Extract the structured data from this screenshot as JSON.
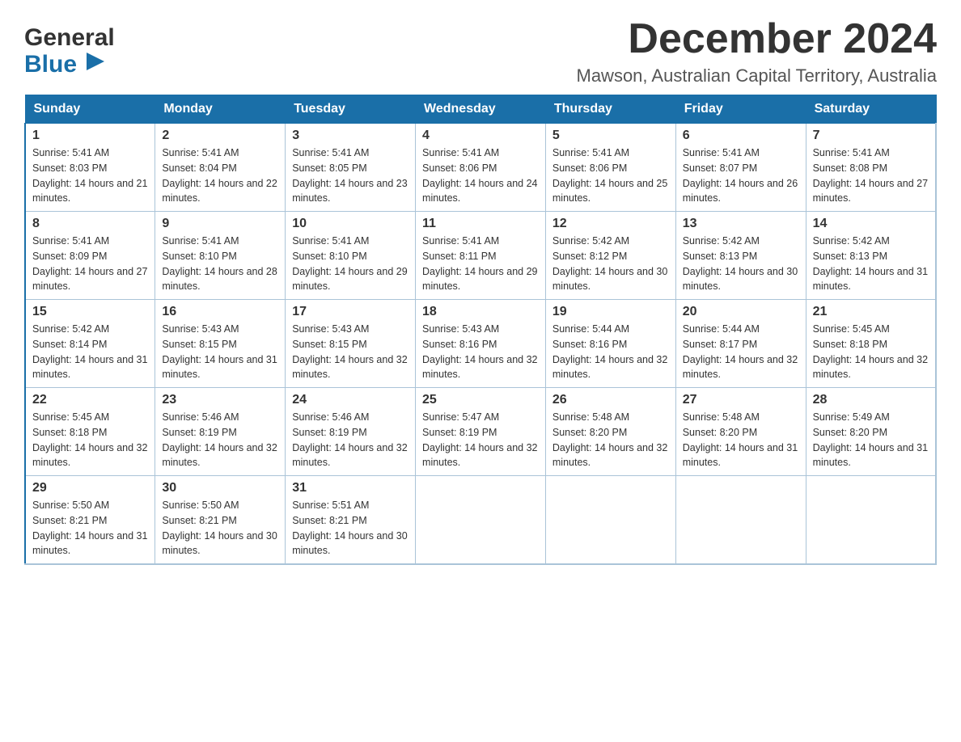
{
  "header": {
    "logo_general": "General",
    "logo_blue": "Blue",
    "month_title": "December 2024",
    "location": "Mawson, Australian Capital Territory, Australia"
  },
  "weekdays": [
    "Sunday",
    "Monday",
    "Tuesday",
    "Wednesday",
    "Thursday",
    "Friday",
    "Saturday"
  ],
  "weeks": [
    [
      {
        "day": "1",
        "sunrise": "5:41 AM",
        "sunset": "8:03 PM",
        "daylight": "14 hours and 21 minutes."
      },
      {
        "day": "2",
        "sunrise": "5:41 AM",
        "sunset": "8:04 PM",
        "daylight": "14 hours and 22 minutes."
      },
      {
        "day": "3",
        "sunrise": "5:41 AM",
        "sunset": "8:05 PM",
        "daylight": "14 hours and 23 minutes."
      },
      {
        "day": "4",
        "sunrise": "5:41 AM",
        "sunset": "8:06 PM",
        "daylight": "14 hours and 24 minutes."
      },
      {
        "day": "5",
        "sunrise": "5:41 AM",
        "sunset": "8:06 PM",
        "daylight": "14 hours and 25 minutes."
      },
      {
        "day": "6",
        "sunrise": "5:41 AM",
        "sunset": "8:07 PM",
        "daylight": "14 hours and 26 minutes."
      },
      {
        "day": "7",
        "sunrise": "5:41 AM",
        "sunset": "8:08 PM",
        "daylight": "14 hours and 27 minutes."
      }
    ],
    [
      {
        "day": "8",
        "sunrise": "5:41 AM",
        "sunset": "8:09 PM",
        "daylight": "14 hours and 27 minutes."
      },
      {
        "day": "9",
        "sunrise": "5:41 AM",
        "sunset": "8:10 PM",
        "daylight": "14 hours and 28 minutes."
      },
      {
        "day": "10",
        "sunrise": "5:41 AM",
        "sunset": "8:10 PM",
        "daylight": "14 hours and 29 minutes."
      },
      {
        "day": "11",
        "sunrise": "5:41 AM",
        "sunset": "8:11 PM",
        "daylight": "14 hours and 29 minutes."
      },
      {
        "day": "12",
        "sunrise": "5:42 AM",
        "sunset": "8:12 PM",
        "daylight": "14 hours and 30 minutes."
      },
      {
        "day": "13",
        "sunrise": "5:42 AM",
        "sunset": "8:13 PM",
        "daylight": "14 hours and 30 minutes."
      },
      {
        "day": "14",
        "sunrise": "5:42 AM",
        "sunset": "8:13 PM",
        "daylight": "14 hours and 31 minutes."
      }
    ],
    [
      {
        "day": "15",
        "sunrise": "5:42 AM",
        "sunset": "8:14 PM",
        "daylight": "14 hours and 31 minutes."
      },
      {
        "day": "16",
        "sunrise": "5:43 AM",
        "sunset": "8:15 PM",
        "daylight": "14 hours and 31 minutes."
      },
      {
        "day": "17",
        "sunrise": "5:43 AM",
        "sunset": "8:15 PM",
        "daylight": "14 hours and 32 minutes."
      },
      {
        "day": "18",
        "sunrise": "5:43 AM",
        "sunset": "8:16 PM",
        "daylight": "14 hours and 32 minutes."
      },
      {
        "day": "19",
        "sunrise": "5:44 AM",
        "sunset": "8:16 PM",
        "daylight": "14 hours and 32 minutes."
      },
      {
        "day": "20",
        "sunrise": "5:44 AM",
        "sunset": "8:17 PM",
        "daylight": "14 hours and 32 minutes."
      },
      {
        "day": "21",
        "sunrise": "5:45 AM",
        "sunset": "8:18 PM",
        "daylight": "14 hours and 32 minutes."
      }
    ],
    [
      {
        "day": "22",
        "sunrise": "5:45 AM",
        "sunset": "8:18 PM",
        "daylight": "14 hours and 32 minutes."
      },
      {
        "day": "23",
        "sunrise": "5:46 AM",
        "sunset": "8:19 PM",
        "daylight": "14 hours and 32 minutes."
      },
      {
        "day": "24",
        "sunrise": "5:46 AM",
        "sunset": "8:19 PM",
        "daylight": "14 hours and 32 minutes."
      },
      {
        "day": "25",
        "sunrise": "5:47 AM",
        "sunset": "8:19 PM",
        "daylight": "14 hours and 32 minutes."
      },
      {
        "day": "26",
        "sunrise": "5:48 AM",
        "sunset": "8:20 PM",
        "daylight": "14 hours and 32 minutes."
      },
      {
        "day": "27",
        "sunrise": "5:48 AM",
        "sunset": "8:20 PM",
        "daylight": "14 hours and 31 minutes."
      },
      {
        "day": "28",
        "sunrise": "5:49 AM",
        "sunset": "8:20 PM",
        "daylight": "14 hours and 31 minutes."
      }
    ],
    [
      {
        "day": "29",
        "sunrise": "5:50 AM",
        "sunset": "8:21 PM",
        "daylight": "14 hours and 31 minutes."
      },
      {
        "day": "30",
        "sunrise": "5:50 AM",
        "sunset": "8:21 PM",
        "daylight": "14 hours and 30 minutes."
      },
      {
        "day": "31",
        "sunrise": "5:51 AM",
        "sunset": "8:21 PM",
        "daylight": "14 hours and 30 minutes."
      },
      null,
      null,
      null,
      null
    ]
  ],
  "labels": {
    "sunrise": "Sunrise:",
    "sunset": "Sunset:",
    "daylight": "Daylight:"
  }
}
